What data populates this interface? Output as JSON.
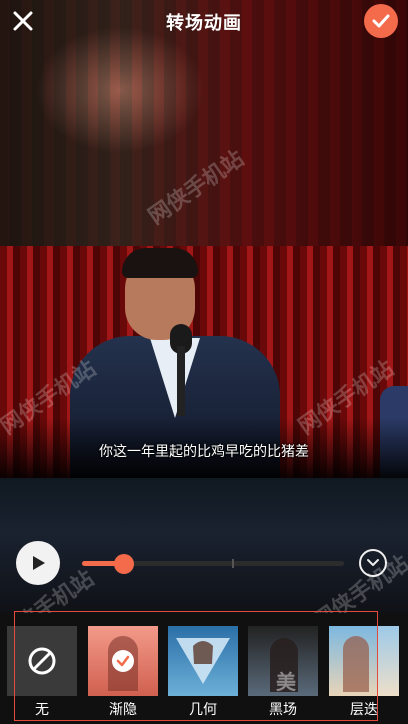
{
  "header": {
    "title": "转场动画",
    "close_icon": "close-icon",
    "confirm_icon": "check-icon"
  },
  "video": {
    "subtitle": "你这一年里起的比鸡早吃的比猪差"
  },
  "playback": {
    "progress": 0.16,
    "play_icon": "play-icon",
    "collapse_icon": "chevron-down-icon"
  },
  "transitions": [
    {
      "label": "无",
      "selected": false
    },
    {
      "label": "渐隐",
      "selected": true
    },
    {
      "label": "几何",
      "selected": false
    },
    {
      "label": "黑场",
      "selected": false
    },
    {
      "label": "层迭",
      "selected": false
    }
  ],
  "watermark": {
    "text": "网侠手机站",
    "bottom_text": "美拍"
  },
  "colors": {
    "accent": "#f36b4b",
    "selection_frame": "#e24a3b"
  }
}
